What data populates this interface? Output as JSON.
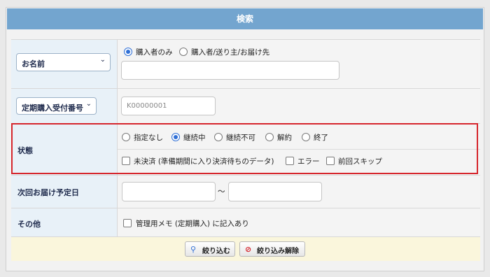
{
  "header": {
    "title": "検索"
  },
  "name_row": {
    "select_label": "お名前",
    "radio_buyer_only": "購入者のみ",
    "radio_buyer_sender": "購入者/送り主/お届け先",
    "name_input_value": ""
  },
  "number_row": {
    "select_label": "定期購入受付番号",
    "input_placeholder": "K00000001"
  },
  "status_row": {
    "label": "状態",
    "radios": [
      "指定なし",
      "継続中",
      "継続不可",
      "解約",
      "終了"
    ],
    "selected": "継続中",
    "checkboxes": [
      "未決済 (準備期間に入り決済待ちのデータ)",
      "エラー",
      "前回スキップ"
    ]
  },
  "next_delivery_row": {
    "label": "次回お届け予定日",
    "separator": "〜"
  },
  "other_row": {
    "label": "その他",
    "checkbox": "管理用メモ (定期購入) に記入あり"
  },
  "actions": {
    "filter_label": "絞り込む",
    "clear_label": "絞り込み解除"
  },
  "colors": {
    "header": "#73a5cf",
    "highlight": "#d6262d",
    "accent": "#2f6fd6"
  }
}
